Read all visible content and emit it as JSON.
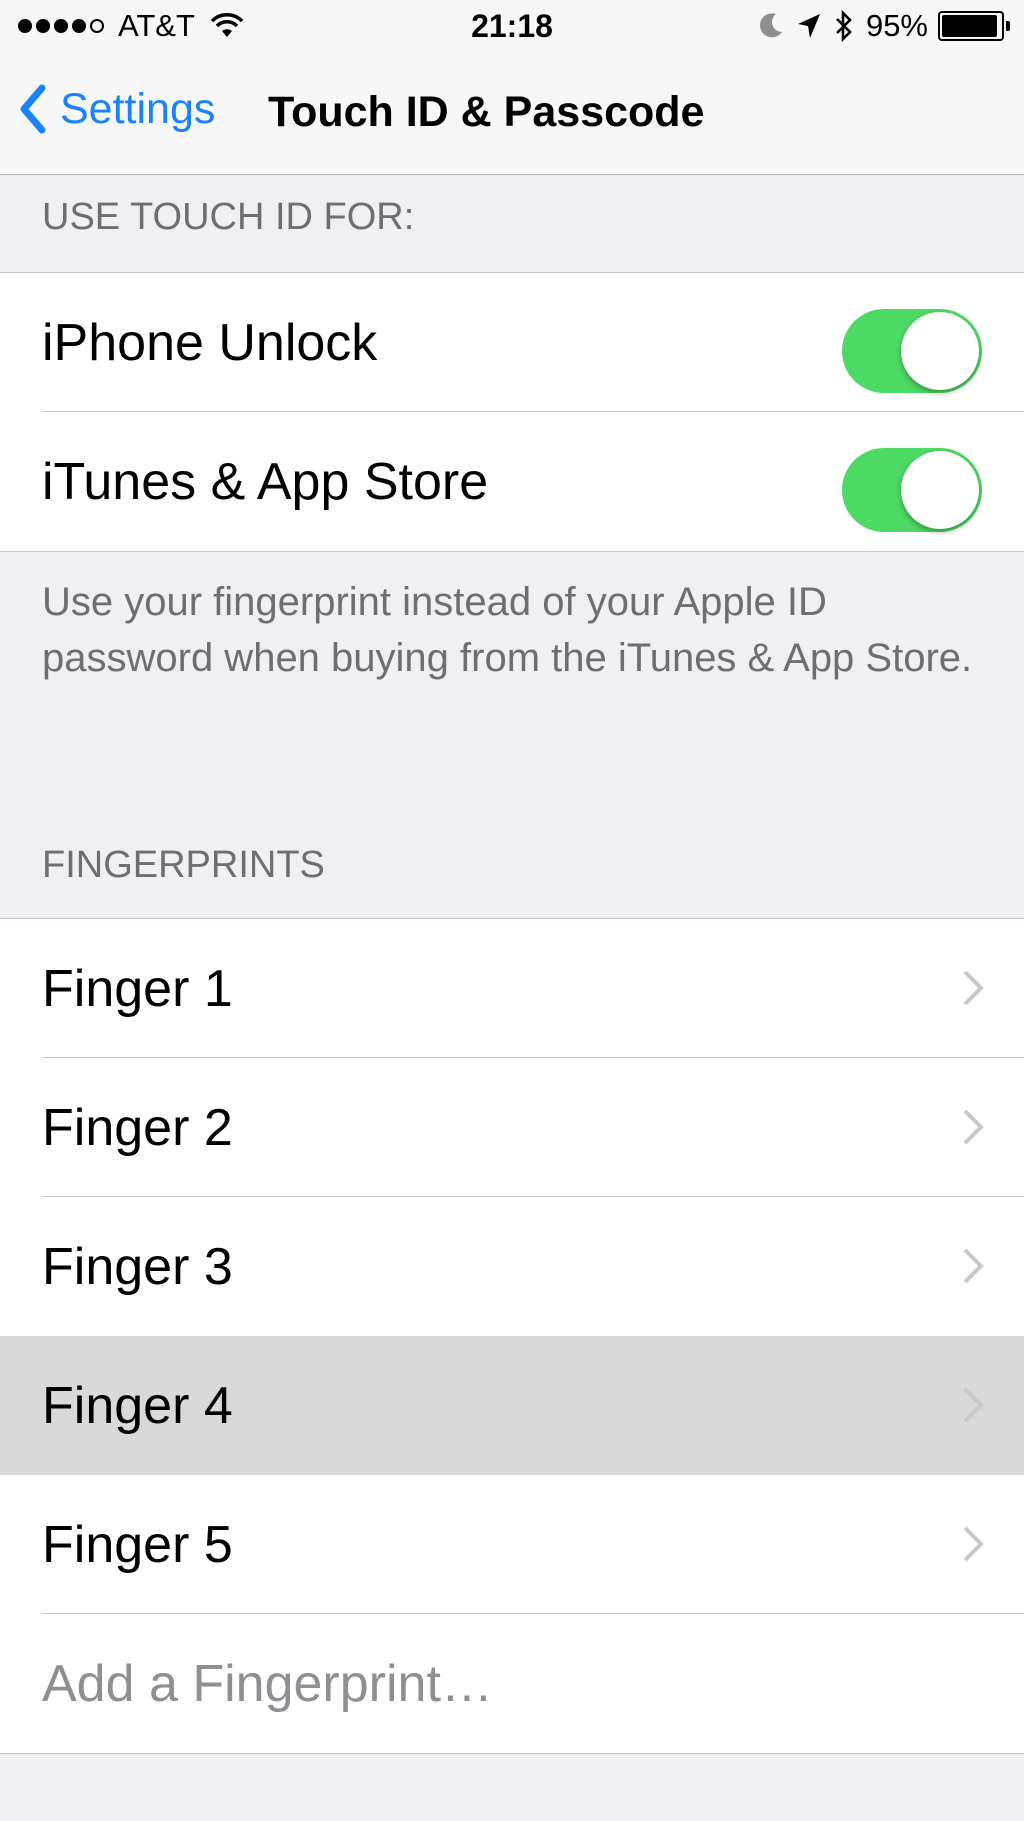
{
  "status_bar": {
    "carrier": "AT&T",
    "time": "21:18",
    "battery_percent": "95%",
    "battery_level": 0.95,
    "signal_bars_filled": 4,
    "signal_bars_total": 5
  },
  "nav": {
    "back_label": "Settings",
    "title": "Touch ID & Passcode"
  },
  "touch_id_section": {
    "header": "USE TOUCH ID FOR:",
    "rows": [
      {
        "label": "iPhone Unlock",
        "enabled": true
      },
      {
        "label": "iTunes & App Store",
        "enabled": true
      }
    ],
    "footer": "Use your fingerprint instead of your Apple ID password when buying from the iTunes & App Store."
  },
  "fingerprints_section": {
    "header": "FINGERPRINTS",
    "fingers": [
      "Finger 1",
      "Finger 2",
      "Finger 3",
      "Finger 4",
      "Finger 5"
    ],
    "highlighted_index": 3,
    "add_label": "Add a Fingerprint…"
  },
  "colors": {
    "accent": "#1a82fb",
    "toggle_on": "#4cd964",
    "background": "#efeff4",
    "section_text": "#6d6d72"
  }
}
